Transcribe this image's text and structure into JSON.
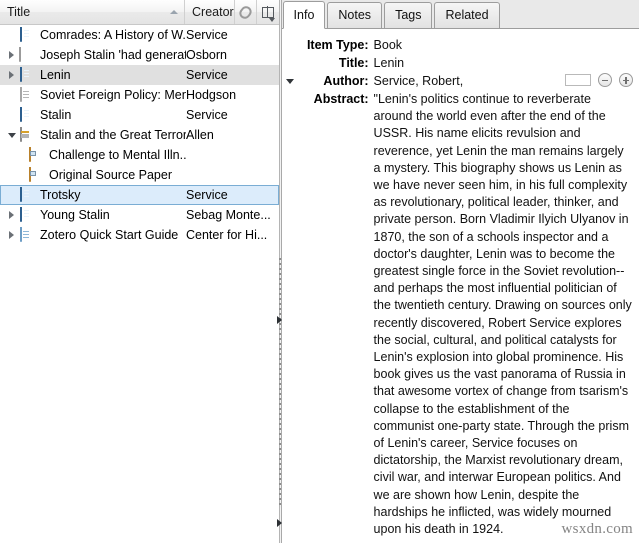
{
  "items_pane": {
    "columns": [
      {
        "label": "Title",
        "sort": "asc"
      },
      {
        "label": "Creator",
        "sort": "none"
      }
    ],
    "header_icons": [
      {
        "name": "paperclip-icon"
      },
      {
        "name": "column-picker-icon"
      }
    ],
    "rows": [
      {
        "title": "Comrades: A History of W...",
        "creator": "Service",
        "icon": "book",
        "level": 1,
        "twisty": "none",
        "state": "normal"
      },
      {
        "title": "Joseph Stalin 'had generati...",
        "creator": "Osborn",
        "icon": "attachment",
        "level": 1,
        "twisty": "closed",
        "state": "normal"
      },
      {
        "title": "Lenin",
        "creator": "Service",
        "icon": "book",
        "level": 1,
        "twisty": "closed",
        "state": "selected-inactive"
      },
      {
        "title": "Soviet Foreign Policy: Men...",
        "creator": "Hodgson",
        "icon": "document",
        "level": 1,
        "twisty": "none",
        "state": "normal"
      },
      {
        "title": "Stalin",
        "creator": "Service",
        "icon": "book",
        "level": 1,
        "twisty": "none",
        "state": "normal"
      },
      {
        "title": "Stalin and the Great Terror...",
        "creator": "Allen",
        "icon": "newspaper",
        "level": 1,
        "twisty": "open",
        "state": "normal"
      },
      {
        "title": "Challenge to Mental Illn...",
        "creator": "",
        "icon": "snapshot",
        "level": 2,
        "twisty": "none",
        "state": "normal"
      },
      {
        "title": "Original Source Paper",
        "creator": "",
        "icon": "snapshot",
        "level": 2,
        "twisty": "none",
        "state": "normal"
      },
      {
        "title": "Trotsky",
        "creator": "Service",
        "icon": "book",
        "level": 1,
        "twisty": "none",
        "state": "selected-active"
      },
      {
        "title": "Young Stalin",
        "creator": "Sebag Monte...",
        "icon": "book",
        "level": 1,
        "twisty": "closed",
        "state": "normal"
      },
      {
        "title": "Zotero Quick Start Guide",
        "creator": "Center for Hi...",
        "icon": "page",
        "level": 1,
        "twisty": "closed",
        "state": "normal"
      }
    ]
  },
  "splitter": {
    "collapse_arrow": "chevron-right-icon"
  },
  "info_pane": {
    "tabs": [
      {
        "label": "Info",
        "active": true
      },
      {
        "label": "Notes",
        "active": false
      },
      {
        "label": "Tags",
        "active": false
      },
      {
        "label": "Related",
        "active": false
      }
    ],
    "fields": [
      {
        "label": "Item Type:",
        "value": "Book",
        "twisty": false,
        "controls": false
      },
      {
        "label": "Title:",
        "value": "Lenin",
        "twisty": false,
        "controls": false
      },
      {
        "label": "Author:",
        "value": "Service, Robert,",
        "twisty": true,
        "controls": true
      },
      {
        "label": "Abstract:",
        "value": "\"Lenin's politics continue to reverberate around the world even after the end of the USSR. His name elicits revulsion and reverence, yet Lenin the man remains largely a mystery. This biography shows us Lenin as we have never seen him, in his full complexity as revolutionary, political leader, thinker, and private person. Born Vladimir Ilyich Ulyanov in 1870, the son of a schools inspector and a doctor's daughter, Lenin was to become the greatest single force in the Soviet revolution--and perhaps the most influential politician of the twentieth century. Drawing on sources only recently discovered, Robert Service explores the social, cultural, and political catalysts for Lenin's explosion into global prominence. His book gives us the vast panorama of Russia in that awesome vortex of change from tsarism's collapse to the establishment of the communist one-party state. Through the prism of Lenin's career, Service focuses on dictatorship, the Marxist revolutionary dream, civil war, and interwar European politics. And we are shown how Lenin, despite the hardships he inflicted, was widely mourned upon his death in 1924.",
        "twisty": false,
        "controls": false
      }
    ],
    "author_controls": {
      "minus": "minus-circle-icon",
      "plus": "plus-circle-icon"
    }
  },
  "watermark": {
    "text": "wsxdn.com"
  },
  "colors": {
    "selection_active_bg": "#dcecfb",
    "selection_active_border": "#7aadd4",
    "selection_inactive_bg": "#e0e0e0",
    "header_bg": "#eeeeee"
  }
}
